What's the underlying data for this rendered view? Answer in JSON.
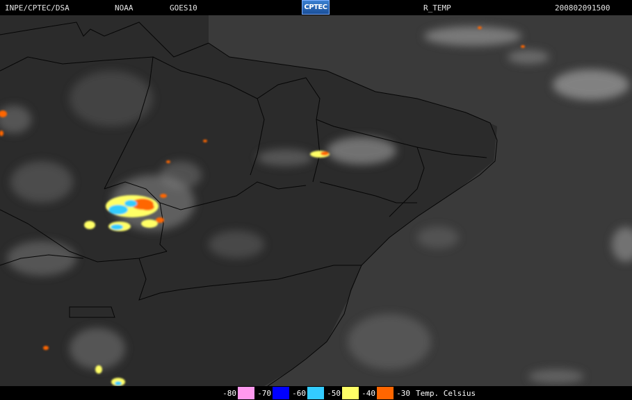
{
  "header": {
    "agency": "INPE/CPTEC/DSA",
    "satellite_operator": "NOAA",
    "satellite": "GOES10",
    "logo_text": "CPTEC",
    "product": "R_TEMP",
    "timestamp": "200802091500"
  },
  "legend": {
    "unit_label": "Temp. Celsius",
    "items": [
      {
        "label": "-80",
        "color": "#ff99ee"
      },
      {
        "label": "-70",
        "color": "#0000ff"
      },
      {
        "label": "-60",
        "color": "#33ccff"
      },
      {
        "label": "-50",
        "color": "#ffff66"
      },
      {
        "label": "-40",
        "color": "#ff6600"
      },
      {
        "label": "-30",
        "color": null
      }
    ]
  },
  "colors": {
    "background": "#000000",
    "land": "#2e2e2e",
    "clouds": "#bdbdbd",
    "borders": "#000000"
  }
}
